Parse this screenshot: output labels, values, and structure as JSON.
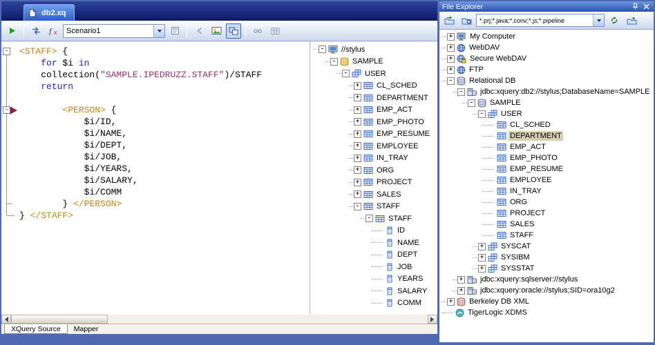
{
  "colors": {
    "frame_blue": "#4e6ab5",
    "tab_active_blue": "#2d5fc8",
    "selection_tan": "#d7d0ae",
    "code_tag": "#c8860a",
    "code_keyword": "#2323cc",
    "code_string": "#993366",
    "run_green": "#18a018"
  },
  "editor_tab": {
    "title": "db2.xq"
  },
  "toolbar": {
    "scenario_value": "Scenario1",
    "left_items": [
      {
        "icon": "run"
      },
      {
        "sep": true
      },
      {
        "icon": "exchange"
      },
      {
        "icon": "function"
      }
    ],
    "right_items": [
      {
        "icon": "scenario-props"
      },
      {
        "sep": true
      },
      {
        "icon": "back",
        "enabled": false
      },
      {
        "icon": "preview"
      },
      {
        "icon": "mapper",
        "pressed": true
      },
      {
        "sep": true
      },
      {
        "icon": "link",
        "enabled": false
      },
      {
        "icon": "grid",
        "enabled": false
      }
    ]
  },
  "editor": {
    "lines": [
      [
        {
          "c": "tag",
          "t": "<STAFF>"
        },
        {
          "c": "pln",
          "t": " {"
        }
      ],
      [
        {
          "c": "pln",
          "t": "    "
        },
        {
          "c": "kw",
          "t": "for"
        },
        {
          "c": "pln",
          "t": " $i "
        },
        {
          "c": "kw",
          "t": "in"
        }
      ],
      [
        {
          "c": "pln",
          "t": "    collection("
        },
        {
          "c": "str",
          "t": "\"SAMPLE.IPEDRUZZ.STAFF\""
        },
        {
          "c": "pln",
          "t": ")/STAFF"
        }
      ],
      [
        {
          "c": "pln",
          "t": "    "
        },
        {
          "c": "kw",
          "t": "return"
        }
      ],
      [],
      [
        {
          "c": "pln",
          "t": "        "
        },
        {
          "c": "tag",
          "t": "<PERSON>"
        },
        {
          "c": "pln",
          "t": " {"
        }
      ],
      [
        {
          "c": "pln",
          "t": "            $i/ID,"
        }
      ],
      [
        {
          "c": "pln",
          "t": "            $i/NAME,"
        }
      ],
      [
        {
          "c": "pln",
          "t": "            $i/DEPT,"
        }
      ],
      [
        {
          "c": "pln",
          "t": "            $i/JOB,"
        }
      ],
      [
        {
          "c": "pln",
          "t": "            $i/YEARS,"
        }
      ],
      [
        {
          "c": "pln",
          "t": "            $i/SALARY,"
        }
      ],
      [
        {
          "c": "pln",
          "t": "            $i/COMM"
        }
      ],
      [
        {
          "c": "pln",
          "t": "        } "
        },
        {
          "c": "tag",
          "t": "</PERSON>"
        }
      ],
      [
        {
          "c": "pln",
          "t": "} "
        },
        {
          "c": "tag",
          "t": "</STAFF>"
        }
      ]
    ]
  },
  "schema_tree": {
    "rows": [
      {
        "depth": 0,
        "expand": "-",
        "icon": "root",
        "label": "//stylus"
      },
      {
        "depth": 1,
        "expand": "-",
        "icon": "dby",
        "label": "SAMPLE"
      },
      {
        "depth": 2,
        "expand": "-",
        "icon": "schema",
        "label": "USER"
      },
      {
        "depth": 3,
        "expand": "+",
        "icon": "table",
        "label": "CL_SCHED"
      },
      {
        "depth": 3,
        "expand": "+",
        "icon": "table",
        "label": "DEPARTMENT"
      },
      {
        "depth": 3,
        "expand": "+",
        "icon": "table",
        "label": "EMP_ACT"
      },
      {
        "depth": 3,
        "expand": "+",
        "icon": "table",
        "label": "EMP_PHOTO"
      },
      {
        "depth": 3,
        "expand": "+",
        "icon": "table",
        "label": "EMP_RESUME"
      },
      {
        "depth": 3,
        "expand": "+",
        "icon": "table",
        "label": "EMPLOYEE"
      },
      {
        "depth": 3,
        "expand": "+",
        "icon": "table",
        "label": "IN_TRAY"
      },
      {
        "depth": 3,
        "expand": "+",
        "icon": "table",
        "label": "ORG"
      },
      {
        "depth": 3,
        "expand": "+",
        "icon": "table",
        "label": "PROJECT"
      },
      {
        "depth": 3,
        "expand": "+",
        "icon": "table",
        "label": "SALES"
      },
      {
        "depth": 3,
        "expand": "-",
        "icon": "table",
        "label": "STAFF"
      },
      {
        "depth": 4,
        "expand": "-",
        "icon": "element",
        "label": "STAFF"
      },
      {
        "depth": 5,
        "icon": "column",
        "label": "ID"
      },
      {
        "depth": 5,
        "icon": "column",
        "label": "NAME"
      },
      {
        "depth": 5,
        "icon": "column",
        "label": "DEPT"
      },
      {
        "depth": 5,
        "icon": "column",
        "label": "JOB"
      },
      {
        "depth": 5,
        "icon": "column",
        "label": "YEARS"
      },
      {
        "depth": 5,
        "icon": "column",
        "label": "SALARY"
      },
      {
        "depth": 5,
        "icon": "column",
        "label": "COMM"
      }
    ]
  },
  "bottom_tabs": [
    {
      "label": "XQuery Source",
      "active": true
    },
    {
      "label": "Mapper",
      "active": false
    }
  ],
  "file_explorer": {
    "title": "File Explorer",
    "filter_value": "*.prj;*.java;*.conv;*.js;*.pipeline",
    "toolbar_left": [
      {
        "icon": "folder-sync"
      },
      {
        "icon": "folder-open"
      }
    ],
    "toolbar_right": [
      {
        "icon": "refresh"
      },
      {
        "icon": "up-folder"
      }
    ],
    "rows": [
      {
        "depth": 0,
        "expand": "+",
        "icon": "computer",
        "label": "My Computer"
      },
      {
        "depth": 0,
        "expand": "+",
        "icon": "globe",
        "label": "WebDAV"
      },
      {
        "depth": 0,
        "expand": "+",
        "icon": "globe-lock",
        "label": "Secure WebDAV"
      },
      {
        "depth": 0,
        "expand": "+",
        "icon": "globe",
        "label": "FTP"
      },
      {
        "depth": 0,
        "expand": "-",
        "icon": "db",
        "label": "Relational DB"
      },
      {
        "depth": 1,
        "expand": "-",
        "icon": "server",
        "label": "jdbc:xquery:db2://stylus;DatabaseName=SAMPLE"
      },
      {
        "depth": 2,
        "expand": "-",
        "icon": "db",
        "label": "SAMPLE"
      },
      {
        "depth": 3,
        "expand": "-",
        "icon": "schema",
        "label": "USER"
      },
      {
        "depth": 4,
        "icon": "table",
        "label": "CL_SCHED"
      },
      {
        "depth": 4,
        "icon": "table",
        "label": "DEPARTMENT",
        "selected": true
      },
      {
        "depth": 4,
        "icon": "table",
        "label": "EMP_ACT"
      },
      {
        "depth": 4,
        "icon": "table",
        "label": "EMP_PHOTO"
      },
      {
        "depth": 4,
        "icon": "table",
        "label": "EMP_RESUME"
      },
      {
        "depth": 4,
        "icon": "table",
        "label": "EMPLOYEE"
      },
      {
        "depth": 4,
        "icon": "table",
        "label": "IN_TRAY"
      },
      {
        "depth": 4,
        "icon": "table",
        "label": "ORG"
      },
      {
        "depth": 4,
        "icon": "table",
        "label": "PROJECT"
      },
      {
        "depth": 4,
        "icon": "table",
        "label": "SALES"
      },
      {
        "depth": 4,
        "icon": "table",
        "label": "STAFF"
      },
      {
        "depth": 3,
        "expand": "+",
        "icon": "schema",
        "label": "SYSCAT"
      },
      {
        "depth": 3,
        "expand": "+",
        "icon": "schema",
        "label": "SYSIBM"
      },
      {
        "depth": 3,
        "expand": "+",
        "icon": "schema",
        "label": "SYSSTAT"
      },
      {
        "depth": 1,
        "expand": "+",
        "icon": "server",
        "label": "jdbc:xquery:sqlserver://stylus"
      },
      {
        "depth": 1,
        "expand": "+",
        "icon": "server",
        "label": "jdbc:xquery:oracle://stylus;SID=ora10g2"
      },
      {
        "depth": 0,
        "expand": "+",
        "icon": "bdb",
        "label": "Berkeley DB XML"
      },
      {
        "depth": 0,
        "icon": "xdms",
        "label": "TigerLogic XDMS"
      }
    ]
  }
}
